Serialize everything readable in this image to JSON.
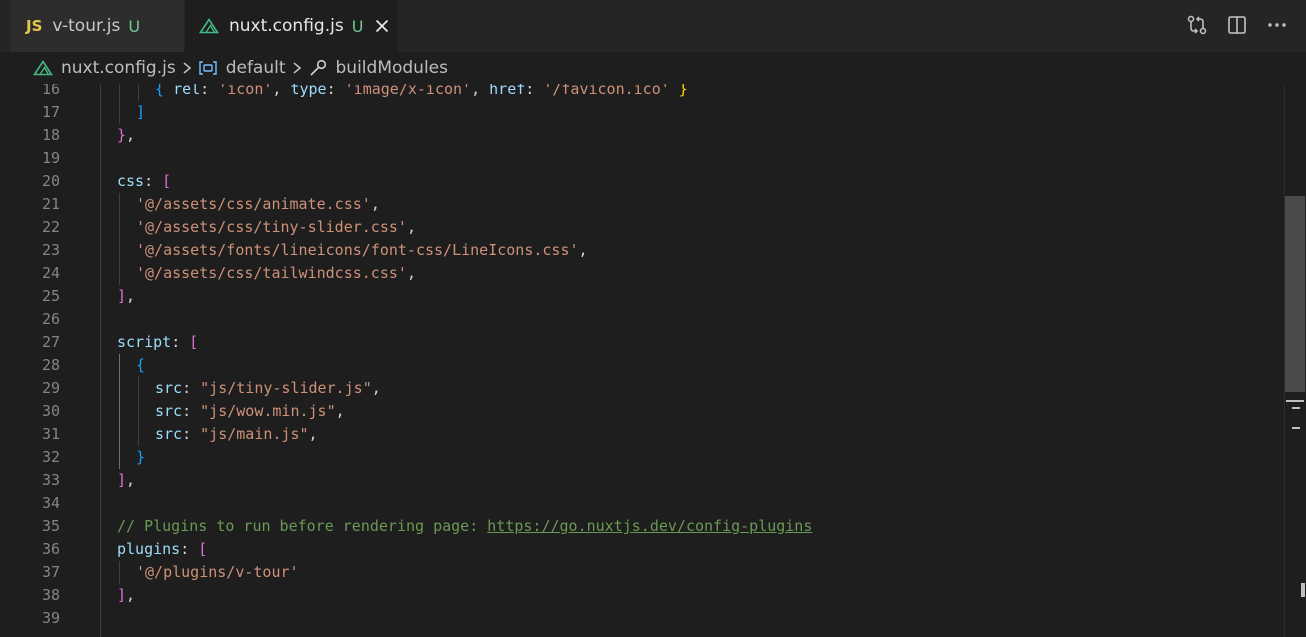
{
  "tabs": [
    {
      "badge": "JS",
      "label": "v-tour.js",
      "status": "U"
    },
    {
      "label": "nuxt.config.js",
      "status": "U"
    }
  ],
  "top_actions": {
    "icons": [
      "source-control-compare-icon",
      "split-editor-icon",
      "more-actions-icon"
    ]
  },
  "breadcrumb": {
    "file": "nuxt.config.js",
    "symbol1": "default",
    "symbol2": "buildModules"
  },
  "editor": {
    "line_numbers": [
      "16",
      "17",
      "18",
      "19",
      "20",
      "21",
      "22",
      "23",
      "24",
      "25",
      "26",
      "27",
      "28",
      "29",
      "30",
      "31",
      "32",
      "33",
      "34",
      "35",
      "36",
      "37",
      "38",
      "39"
    ],
    "code": {
      "l16": {
        "open": "{ ",
        "k1": "rel",
        "c1": ": ",
        "s1": "'icon'",
        "m1": ", ",
        "k2": "type",
        "c2": ": ",
        "s2": "'image/x-icon'",
        "m2": ", ",
        "k3": "href",
        "c3": ": ",
        "s3": "'/favicon.ico'",
        "close": " }"
      },
      "l17": {
        "text": "]"
      },
      "l18": {
        "brace": "}",
        "comma": ","
      },
      "l20": {
        "key": "css",
        "colon": ": ",
        "bracket": "["
      },
      "l21": {
        "str": "'@/assets/css/animate.css'",
        "comma": ","
      },
      "l22": {
        "str": "'@/assets/css/tiny-slider.css'",
        "comma": ","
      },
      "l23": {
        "str": "'@/assets/fonts/lineicons/font-css/LineIcons.css'",
        "comma": ","
      },
      "l24": {
        "str": "'@/assets/css/tailwindcss.css'",
        "comma": ","
      },
      "l25": {
        "bracket": "]",
        "comma": ","
      },
      "l27": {
        "key": "script",
        "colon": ": ",
        "bracket": "["
      },
      "l28": {
        "brace": "{"
      },
      "l29": {
        "key": "src",
        "colon": ": ",
        "str": "\"js/tiny-slider.js\"",
        "comma": ","
      },
      "l30": {
        "key": "src",
        "colon": ": ",
        "str": "\"js/wow.min.js\"",
        "comma": ","
      },
      "l31": {
        "key": "src",
        "colon": ": ",
        "str": "\"js/main.js\"",
        "comma": ","
      },
      "l32": {
        "brace": "}"
      },
      "l33": {
        "bracket": "]",
        "comma": ","
      },
      "l35": {
        "comment": "// Plugins to run before rendering page: ",
        "url": "https://go.nuxtjs.dev/config-plugins"
      },
      "l36": {
        "key": "plugins",
        "colon": ": ",
        "bracket": "["
      },
      "l37": {
        "str": "'@/plugins/v-tour'"
      },
      "l38": {
        "bracket": "]",
        "comma": ","
      }
    }
  },
  "colors": {
    "editor_bg": "#1e1e1e",
    "tabbar_bg": "#252526",
    "string": "#ce9178",
    "property": "#9cdcfe",
    "comment": "#6a9955",
    "untracked": "#73c991",
    "js_badge": "#e8c84a",
    "nuxt_green": "#41b883"
  }
}
